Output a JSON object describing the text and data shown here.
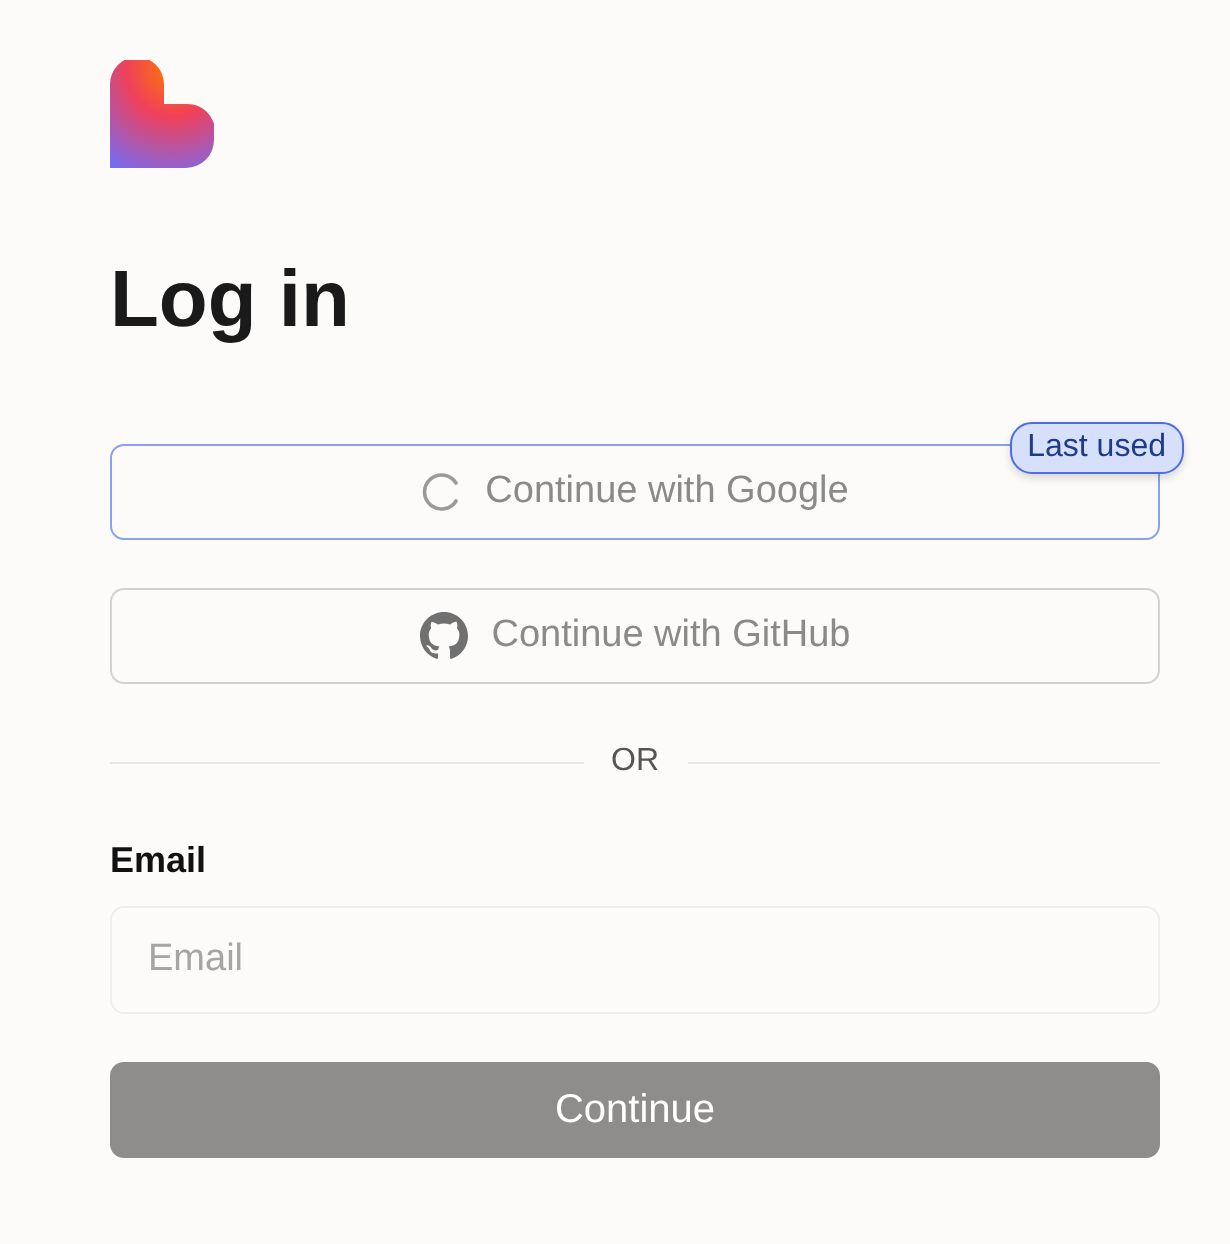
{
  "title": "Log in",
  "providers": [
    {
      "kind": "google",
      "label": "Continue with Google",
      "loading": true,
      "disabled": true,
      "badge": "Last used"
    },
    {
      "kind": "github",
      "label": "Continue with GitHub",
      "loading": false,
      "disabled": true
    }
  ],
  "divider": "OR",
  "email": {
    "label": "Email",
    "placeholder": "Email"
  },
  "submit": {
    "label": "Continue",
    "disabled": true
  }
}
